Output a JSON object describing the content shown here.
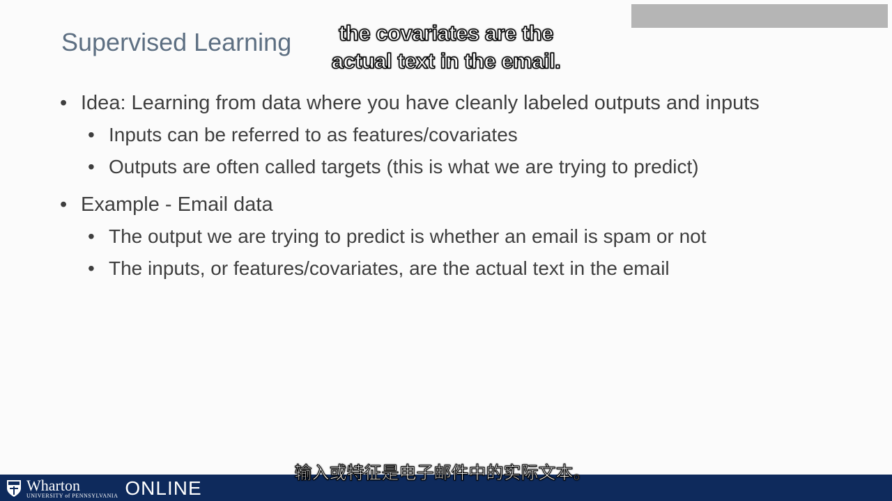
{
  "slide": {
    "title": "Supervised Learning",
    "bullets": [
      {
        "text": "Idea: Learning from data where you have cleanly labeled outputs and inputs",
        "sub": [
          "Inputs can be referred to as features/covariates",
          "Outputs are often called targets (this is what we are trying to predict)"
        ]
      },
      {
        "text": "Example - Email data",
        "sub": [
          "The output we are trying to predict is whether an email is spam or not",
          "The inputs, or features/covariates, are the actual text in the email"
        ]
      }
    ],
    "bullet_glyph": "•"
  },
  "captions": {
    "top_line1": "the covariates are the",
    "top_line2": "actual text in the email.",
    "bottom": "输入或特征是电子邮件中的实际文本。"
  },
  "footer": {
    "brand": "Wharton",
    "university": "UNIVERSITY of PENNSYLVANIA",
    "product": "ONLINE",
    "icon": "shield-icon",
    "bar_color": "#0e2a5c"
  },
  "colors": {
    "title": "#5d6f82",
    "text": "#3e3e3e",
    "background": "#fbfbfb"
  }
}
